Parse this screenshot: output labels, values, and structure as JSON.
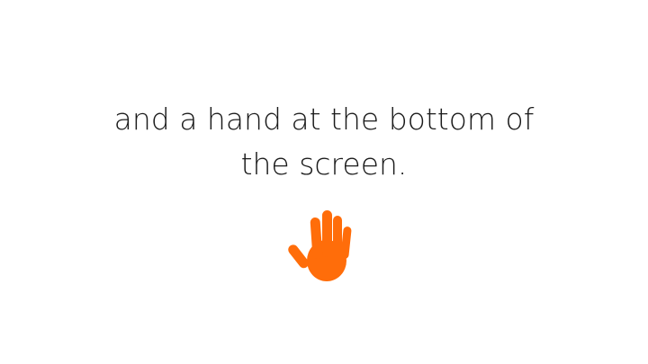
{
  "slide": {
    "text_lines": [
      "and a hand at the bottom of",
      "the screen."
    ],
    "hand_icon": "raised-hand-icon",
    "hand_color": "#FF6D0A",
    "text_color": "#1a1a1a",
    "background": "#ffffff"
  }
}
